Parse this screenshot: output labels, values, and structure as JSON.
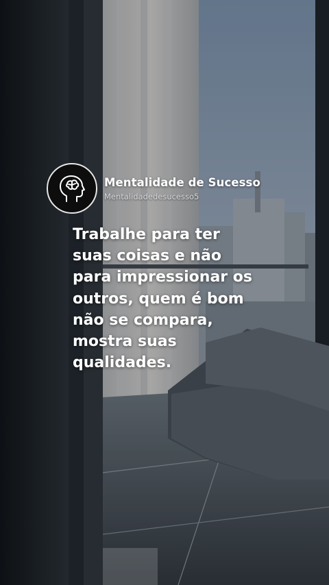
{
  "profile": {
    "name": "Mentalidade de Sucesso",
    "handle": "Mentalidadedesucesso5",
    "avatar_icon": "brain-head-icon"
  },
  "quote": {
    "lines": [
      "Trabalhe para ter",
      "suas coisas e não",
      "para impressionar os",
      "outros, quem é bom",
      "não se compara,",
      "mostra suas",
      "qualidades."
    ]
  },
  "colors": {
    "text": "#ffffff",
    "handle": "#d4d7db",
    "avatar_bg": "#0d0d0d",
    "avatar_ring": "#e8e8e8"
  },
  "background": {
    "scene": "city-view-from-window-with-armchair"
  }
}
